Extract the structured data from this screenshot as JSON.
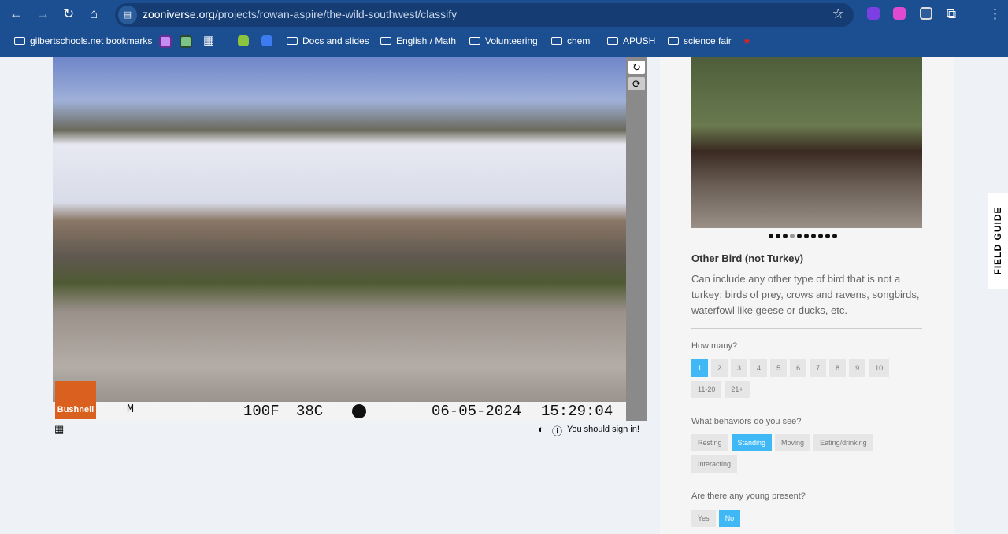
{
  "browser": {
    "url_host": "zooniverse.org",
    "url_path": "/projects/rowan-aspire/the-wild-southwest/classify",
    "bookmarks": [
      "gilbertschools.net bookmarks",
      "Docs and slides",
      "English / Math",
      "Volunteering",
      "chem",
      "APUSH",
      "science fair"
    ]
  },
  "subject": {
    "camera_brand": "Bushnell",
    "temp_f": "100F",
    "temp_c": "38C",
    "date": "06-05-2024",
    "time": "15:29:04",
    "mode": "M"
  },
  "sign_in": "You should sign in!",
  "field_guide": {
    "label": "FIELD GUIDE",
    "title": "Other Bird (not Turkey)",
    "description": "Can include any other type of bird that is not a turkey: birds of prey, crows and ravens, songbirds, waterfowl like geese or ducks, etc.",
    "dots_total": 10,
    "dot_active": 4
  },
  "questions": {
    "how_many": {
      "label": "How many?",
      "options": [
        "1",
        "2",
        "3",
        "4",
        "5",
        "6",
        "7",
        "8",
        "9",
        "10",
        "11-20",
        "21+"
      ],
      "selected": "1"
    },
    "behaviors": {
      "label": "What behaviors do you see?",
      "options": [
        "Resting",
        "Standing",
        "Moving",
        "Eating/drinking",
        "Interacting"
      ],
      "selected": "Standing"
    },
    "young": {
      "label": "Are there any young present?",
      "options": [
        "Yes",
        "No"
      ],
      "selected": "No"
    }
  },
  "colors": {
    "accent": "#3fb8f5",
    "chrome": "#1b4f91"
  }
}
